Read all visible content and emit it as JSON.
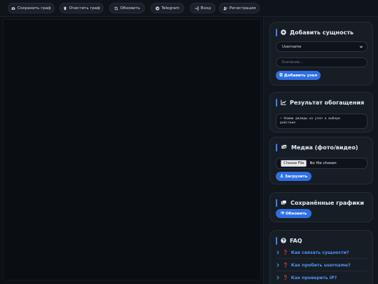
{
  "toolbar": {
    "save": "Сохранить граф",
    "clear": "Очистить граф",
    "refresh": "Обновить",
    "telegram": "Telegram",
    "login": "Вход",
    "register": "Регистрация"
  },
  "add_entity": {
    "title": "Добавить сущность",
    "type_selected": "Username",
    "value_placeholder": "Значение...",
    "button": "Добавить узел"
  },
  "enrich": {
    "title": "Результат обогащения",
    "hint_line1": "⚡ Нажми дважды на узел и выбери",
    "hint_line2": "действие"
  },
  "media": {
    "title": "Медиа (фото/видео)",
    "choose_file": "Choose File",
    "no_file": "No file chosen",
    "upload": "Загрузить"
  },
  "saved": {
    "title": "Сохранённые графики",
    "refresh": "Обновить"
  },
  "faq": {
    "title": "FAQ",
    "items": [
      {
        "question": "Как связать сущности?"
      },
      {
        "question": "Как пробить username?"
      },
      {
        "question": "Как проверить IP?"
      }
    ]
  },
  "colors": {
    "accent": "#3b82f6",
    "button": "#2f6fe4",
    "link": "#4d93f5",
    "question_mark": "#e5484d",
    "background": "#0d1117"
  },
  "icons": [
    "camera-icon",
    "trash-icon",
    "refresh-icon",
    "telegram-icon",
    "login-icon",
    "user-plus-icon",
    "plus-circle-icon",
    "chart-line-icon",
    "images-icon",
    "photo-film-icon",
    "question-circle-icon",
    "upload-icon",
    "list-icon",
    "chevron-right-icon",
    "chevron-down-icon"
  ]
}
